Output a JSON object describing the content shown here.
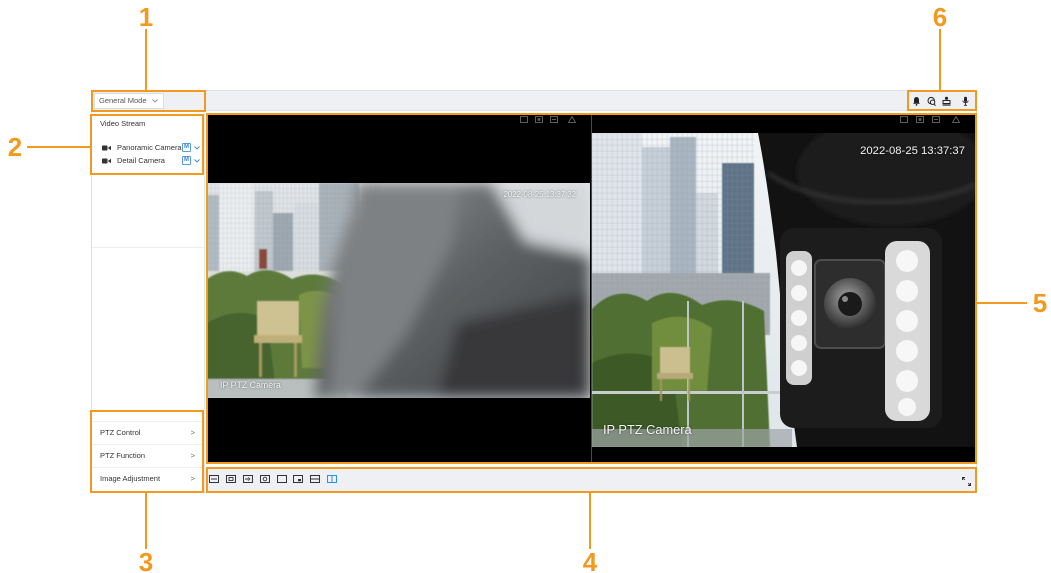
{
  "callouts": {
    "n1": "1",
    "n2": "2",
    "n3": "3",
    "n4": "4",
    "n5": "5",
    "n6": "6"
  },
  "colors": {
    "callout": "#F29A1F",
    "active_icon": "#2F8FE5",
    "header_bg": "#EEF0F3",
    "video_bg": "#000000"
  },
  "header": {
    "mode_select": {
      "value": "General Mode"
    },
    "tool_icons": [
      "bell-icon",
      "circle-arrows-icon",
      "monitor-icon",
      "microphone-icon"
    ]
  },
  "sidebar": {
    "video_stream": {
      "title": "Video Stream",
      "cameras": [
        {
          "label": "Panoramic Camera",
          "stream_badge": "M"
        },
        {
          "label": "Detail Camera",
          "stream_badge": "M"
        }
      ]
    },
    "menu": [
      {
        "label": "PTZ Control",
        "arrow": ">"
      },
      {
        "label": "PTZ Function",
        "arrow": ">"
      },
      {
        "label": "Image Adjustment",
        "arrow": ">"
      }
    ]
  },
  "live_view": {
    "windows": [
      {
        "timestamp": "2022-08-25 13:37:32",
        "caption": "IP PTZ Camera"
      },
      {
        "timestamp": "2022-08-25 13:37:37",
        "caption": "IP PTZ Camera"
      }
    ]
  },
  "footer_toolbar": {
    "icons": [
      "original-size-icon",
      "digital-zoom-icon",
      "instant-playback-icon",
      "snapshot-icon",
      "single-window-icon",
      "picture-in-picture-icon",
      "split-horizontal-icon",
      "split-vertical-icon"
    ],
    "active_icon": "split-vertical-icon",
    "right_icon": "fullscreen-icon"
  }
}
